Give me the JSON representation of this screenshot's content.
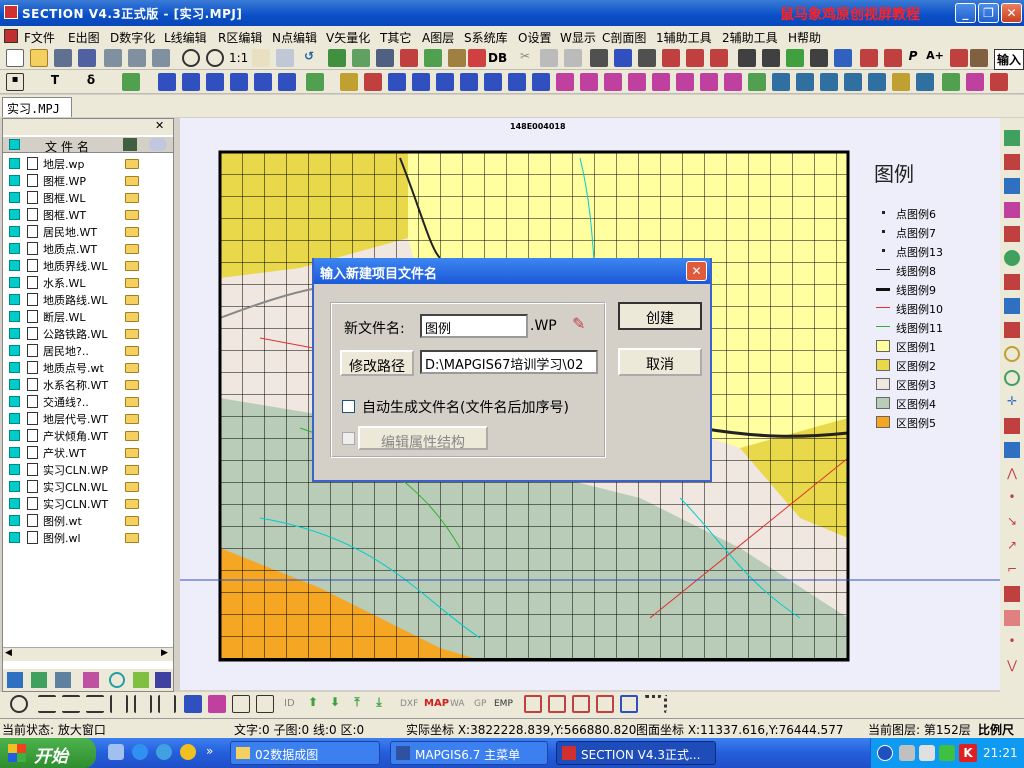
{
  "window": {
    "title": "SECTION V4.3正式版 - [实习.MPJ]",
    "watermark": "鼠马象鸡原创视屏教程"
  },
  "menu": [
    "F文件",
    "E出图",
    "D数字化",
    "L线编辑",
    "R区编辑",
    "N点编辑",
    "V矢量化",
    "T其它",
    "A图层",
    "S系统库",
    "O设置",
    "W显示",
    "C剖面图",
    "1辅助工具",
    "2辅助工具",
    "H帮助"
  ],
  "toolbar": {
    "zoom_label": "1:1",
    "db_label": "DB",
    "input_label": "输入"
  },
  "doc_tab": "实习.MPJ",
  "layer_panel": {
    "header": "文件名",
    "files": [
      "地层.wp",
      "图框.WP",
      "图框.WL",
      "图框.WT",
      "居民地.WT",
      "地质点.WT",
      "地质界线.WL",
      "水系.WL",
      "地质路线.WL",
      "断层.WL",
      "公路铁路.WL",
      "居民地?..",
      "地质点号.wt",
      "水系名称.WT",
      "交通线?..",
      "地层代号.WT",
      "产状倾角.WT",
      "产状.WT",
      "实习CLN.WP",
      "实习CLN.WL",
      "实习CLN.WT",
      "图例.wt",
      "图例.wl"
    ]
  },
  "map": {
    "legend_title": "图例",
    "legend_items": [
      "点图例6",
      "点图例7",
      "点图例13",
      "线图例8",
      "线图例9",
      "线图例10",
      "线图例11",
      "区图例1",
      "区图例2",
      "区图例3",
      "区图例4",
      "区图例5"
    ],
    "legend_colors": [
      "#222",
      "#222",
      "#222",
      "#222",
      "#111",
      "#e03030",
      "#30b030",
      "#ffffa0",
      "#e8d84a",
      "#f0e8e0",
      "#b8ccb8",
      "#f5a623"
    ],
    "top_label": "148E004018"
  },
  "dialog": {
    "title": "输入新建项目文件名",
    "filename_label": "新文件名:",
    "filename_value": "图例",
    "ext": ".WP",
    "path_button": "修改路径",
    "path_value": "D:\\MAPGIS67培训学习\\02",
    "auto_name_label": "自动生成文件名(文件名后加序号)",
    "edit_attr_label": "编辑属性结构",
    "create_button": "创建",
    "cancel_button": "取消"
  },
  "bottom_toolbar": {
    "id": "ID",
    "dxf": "DXF",
    "map": "MAP",
    "wa": "WA",
    "gp": "GP",
    "emp": "EMP"
  },
  "status": {
    "state": "当前状态: 放大窗口",
    "counts": "文字:0 子图:0 线:0 区:0",
    "real_coord": "实际坐标 X:3822228.839,Y:566880.820",
    "map_coord": "图面坐标 X:11337.616,Y:76444.577",
    "layer": "当前图层: 第152层",
    "scale": "比例尺"
  },
  "taskbar": {
    "start": "开始",
    "tasks": [
      "02数据成图",
      "MAPGIS6.7 主菜单",
      "SECTION V4.3正式..."
    ],
    "clock": "21:21"
  }
}
